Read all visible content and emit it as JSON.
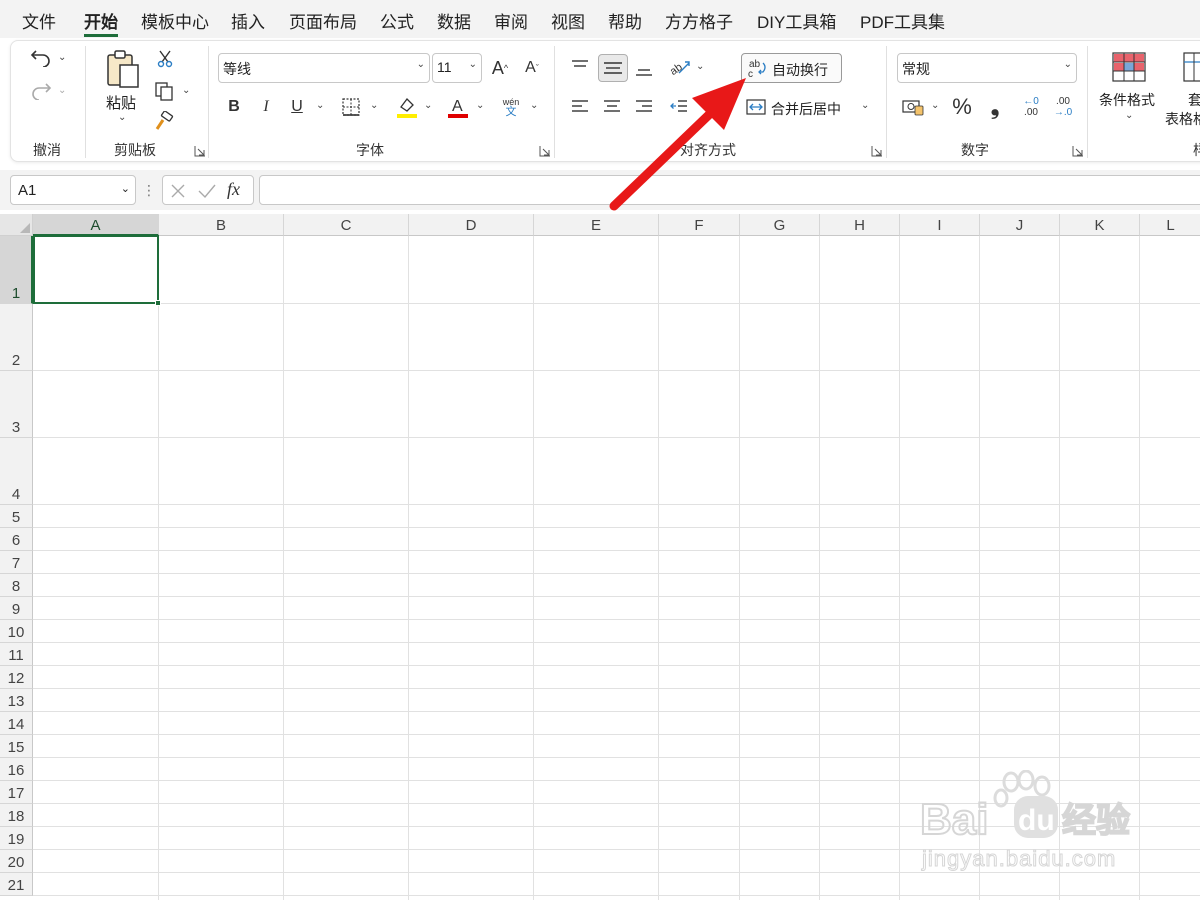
{
  "menu": {
    "tabs": [
      "文件",
      "开始",
      "模板中心",
      "插入",
      "页面布局",
      "公式",
      "数据",
      "审阅",
      "视图",
      "帮助",
      "方方格子",
      "DIY工具箱",
      "PDF工具集"
    ],
    "active_tab": "开始"
  },
  "ribbon": {
    "undo_group": {
      "title": "撤消"
    },
    "clipboard": {
      "paste_label": "粘贴",
      "title": "剪贴板"
    },
    "font": {
      "font_name": "等线",
      "font_size": "11",
      "phonetic_top": "wén",
      "phonetic_bottom": "文",
      "title": "字体",
      "highlight_color": "#ffee00",
      "font_color": "#e00000"
    },
    "alignment": {
      "wrap_text_label": "自动换行",
      "merge_center_label": "合并后居中",
      "title": "对齐方式"
    },
    "number": {
      "format": "常规",
      "title": "数字",
      "percent_symbol": "%",
      "comma_symbol": "❟",
      "inc_decimal_top": "←0",
      "inc_decimal_bottom": ".00",
      "dec_decimal_top": ".00",
      "dec_decimal_bottom": "→.0"
    },
    "styles": {
      "conditional_format_label": "条件格式",
      "table_format_label_top": "套",
      "table_format_label": "表格格",
      "title": "样"
    }
  },
  "formula_bar": {
    "name_box": "A1",
    "fx_symbol": "fx",
    "formula": ""
  },
  "sheet": {
    "columns": [
      "A",
      "B",
      "C",
      "D",
      "E",
      "F",
      "G",
      "H",
      "I",
      "J",
      "K",
      "L"
    ],
    "rows": [
      "1",
      "2",
      "3",
      "4",
      "5",
      "6",
      "7",
      "8",
      "9",
      "10",
      "11",
      "12",
      "13",
      "14",
      "15",
      "16",
      "17",
      "18",
      "19",
      "20",
      "21"
    ],
    "selected_cell": "A1"
  },
  "watermark": {
    "brand": "Bai",
    "brand2": "du",
    "text": "经验",
    "url": "jingyan.baidu.com"
  },
  "colors": {
    "accent": "#1e6d3a",
    "annotation_arrow": "#e81818"
  }
}
